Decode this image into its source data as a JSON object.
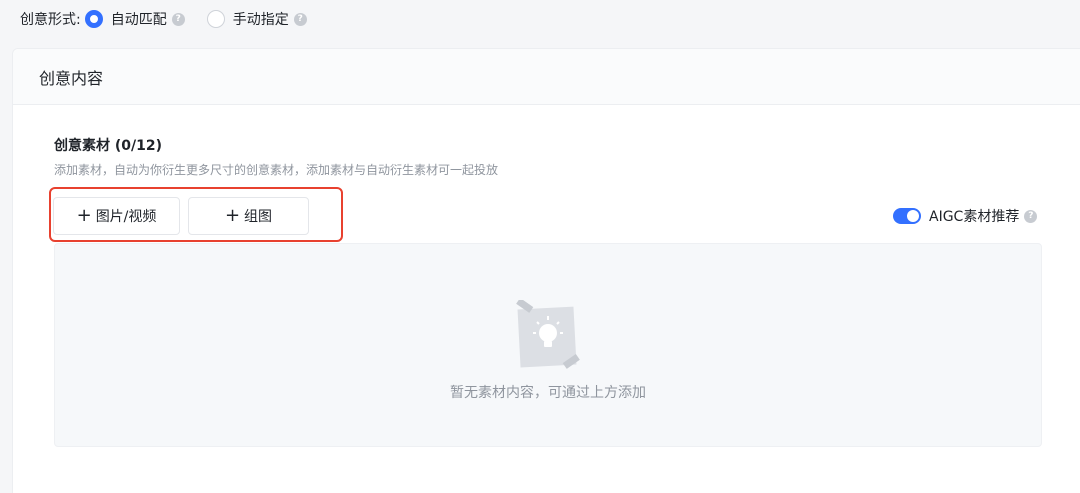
{
  "creative_form": {
    "label": "创意形式:",
    "options": [
      {
        "label": "自动匹配",
        "checked": true
      },
      {
        "label": "手动指定",
        "checked": false
      }
    ]
  },
  "card": {
    "title": "创意内容",
    "section_title": "创意素材 (0/12)",
    "section_desc": "添加素材，自动为你衍生更多尺寸的创意素材，添加素材与自动衍生素材可一起投放",
    "buttons": {
      "media": "图片/视频",
      "group": "组图"
    },
    "aigc": {
      "label": "AIGC素材推荐",
      "enabled": true
    },
    "empty_text": "暂无素材内容，可通过上方添加"
  },
  "colors": {
    "accent": "#3370ff",
    "highlight_border": "#e8412f"
  },
  "icons": {
    "help": "help-icon",
    "plus": "plus-icon",
    "empty": "lightbulb-icon"
  }
}
